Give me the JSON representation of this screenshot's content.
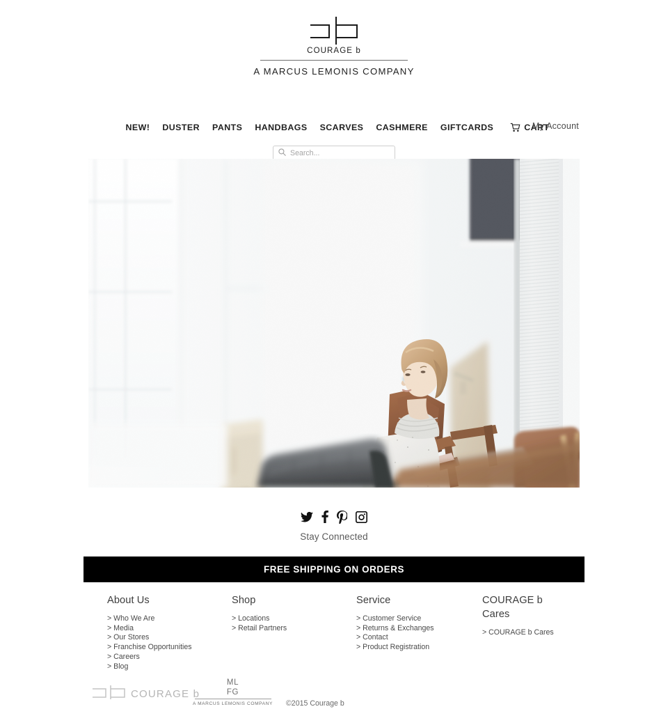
{
  "brand": {
    "logo_word": "COURAGE  b",
    "tagline": "A MARCUS LEMONIS COMPANY",
    "logo_icon": "cb-monogram-icon"
  },
  "nav": {
    "items": [
      {
        "label": "NEW!"
      },
      {
        "label": "DUSTER"
      },
      {
        "label": "PANTS"
      },
      {
        "label": "HANDBAGS"
      },
      {
        "label": "SCARVES"
      },
      {
        "label": "CASHMERE"
      },
      {
        "label": "GIFTCARDS"
      }
    ],
    "cart_label": "CART",
    "cart_icon": "shopping-cart-icon",
    "my_account_label": "My Account"
  },
  "search": {
    "placeholder": "Search...",
    "value": "",
    "icon": "search-icon"
  },
  "hero": {
    "alt": "Woman in speckled knit poncho leaning on wooden chair in bright loft interior"
  },
  "social": {
    "caption": "Stay Connected",
    "icons": [
      {
        "name": "twitter-icon",
        "label": "Twitter"
      },
      {
        "name": "facebook-icon",
        "label": "Facebook"
      },
      {
        "name": "pinterest-icon",
        "label": "Pinterest"
      },
      {
        "name": "instagram-icon",
        "label": "Instagram"
      }
    ]
  },
  "banner": {
    "text": "FREE SHIPPING ON ORDERS",
    "bg_color": "#000000",
    "text_color": "#ffffff"
  },
  "footer": {
    "columns": [
      {
        "title": "About Us",
        "links": [
          "> Who We Are",
          "> Media",
          "> Our Stores",
          "> Franchise Opportunities",
          "> Careers",
          "> Blog"
        ]
      },
      {
        "title": "Shop",
        "links": [
          "> Locations",
          "> Retail Partners"
        ]
      },
      {
        "title": "Service",
        "links": [
          "> Customer Service",
          "> Returns & Exchanges",
          "> Contact",
          "> Product Registration"
        ]
      },
      {
        "title": "COURAGE b",
        "title2": "Cares",
        "links": [
          "> COURAGE b Cares"
        ]
      }
    ]
  },
  "bottom": {
    "logo_word": "COURAGE b",
    "mlfg_line1": "ML",
    "mlfg_line2": "FG",
    "mlfg_tagline": "A MARCUS LEMONIS COMPANY",
    "copyright": "©2015 Courage b"
  }
}
